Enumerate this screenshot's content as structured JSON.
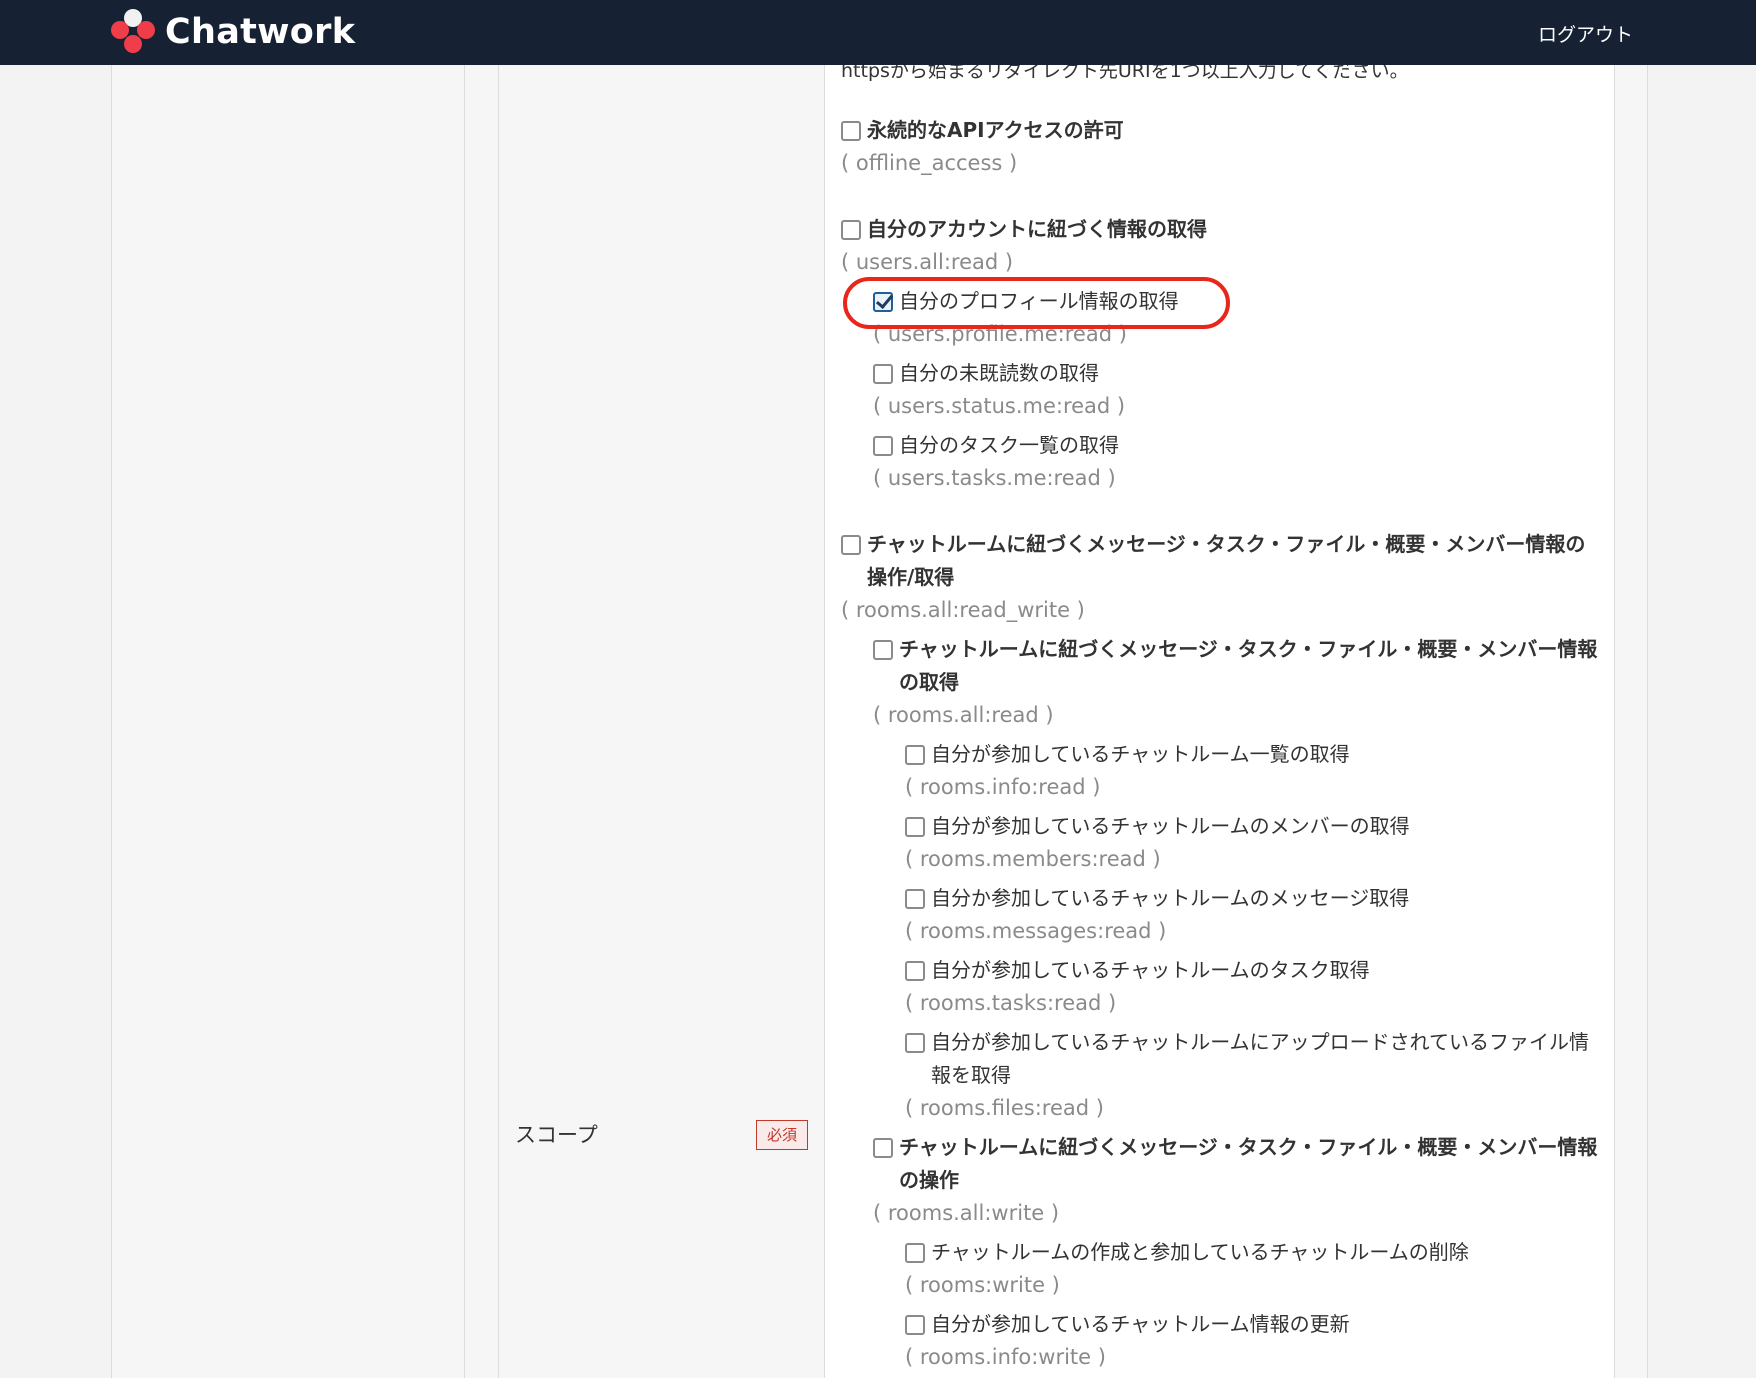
{
  "header": {
    "brand": "Chatwork",
    "logout_label": "ログアウト"
  },
  "redirect_hint": "httpsから始まるリダイレクト先URIを1つ以上入力してください。",
  "scope": {
    "label": "スコープ",
    "required_badge": "必須",
    "items": [
      {
        "title": "永続的なAPIアクセスの許可",
        "code": "( offline_access )",
        "checked": false
      },
      {
        "title": "自分のアカウントに紐づく情報の取得",
        "code": "( users.all:read )",
        "checked": false
      },
      {
        "title": "自分のプロフィール情報の取得",
        "code": "( users.profile.me:read )",
        "checked": true
      },
      {
        "title": "自分の未既読数の取得",
        "code": "( users.status.me:read )",
        "checked": false
      },
      {
        "title": "自分のタスク一覧の取得",
        "code": "( users.tasks.me:read )",
        "checked": false
      },
      {
        "title": "チャットルームに紐づくメッセージ・タスク・ファイル・概要・メンバー情報の操作/取得",
        "code": "( rooms.all:read_write )",
        "checked": false
      },
      {
        "title": "チャットルームに紐づくメッセージ・タスク・ファイル・概要・メンバー情報の取得",
        "code": "( rooms.all:read )",
        "checked": false
      },
      {
        "title": "自分が参加しているチャットルーム一覧の取得",
        "code": "( rooms.info:read )",
        "checked": false
      },
      {
        "title": "自分が参加しているチャットルームのメンバーの取得",
        "code": "( rooms.members:read )",
        "checked": false
      },
      {
        "title": "自分か参加しているチャットルームのメッセージ取得",
        "code": "( rooms.messages:read )",
        "checked": false
      },
      {
        "title": "自分が参加しているチャットルームのタスク取得",
        "code": "( rooms.tasks:read )",
        "checked": false
      },
      {
        "title": "自分が参加しているチャットルームにアップロードされているファイル情報を取得",
        "code": "( rooms.files:read )",
        "checked": false
      },
      {
        "title": "チャットルームに紐づくメッセージ・タスク・ファイル・概要・メンバー情報の操作",
        "code": "( rooms.all:write )",
        "checked": false
      },
      {
        "title": "チャットルームの作成と参加しているチャットルームの削除",
        "code": "( rooms:write )",
        "checked": false
      },
      {
        "title": "自分が参加しているチャットルーム情報の更新",
        "code": "( rooms.info:write )",
        "checked": false
      }
    ]
  }
}
